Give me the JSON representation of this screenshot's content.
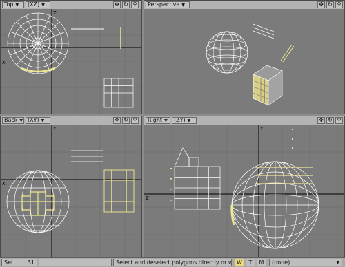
{
  "viewports": {
    "top": {
      "title": "Top",
      "axes": "(XZ)"
    },
    "perspective": {
      "title": "Perspective"
    },
    "back": {
      "title": "Back",
      "axes": "(XY)"
    },
    "right": {
      "title": "Right",
      "axes": "(ZY)"
    }
  },
  "axis_labels": {
    "x": "X",
    "z": "Z",
    "y": "Y"
  },
  "icons": [
    "move-view-icon",
    "rotate-view-icon",
    "zoom-view-icon"
  ],
  "status": {
    "sel_label": "Sel",
    "sel_count": "31",
    "hint": "Select and deselect polygons directly or with las...",
    "buttons": [
      "W",
      "T",
      "M"
    ],
    "surface_value": "(none)"
  },
  "colors": {
    "viewport_bg": "#7b7b7b",
    "wire": "#ffffff",
    "selected": "#f0e890"
  }
}
